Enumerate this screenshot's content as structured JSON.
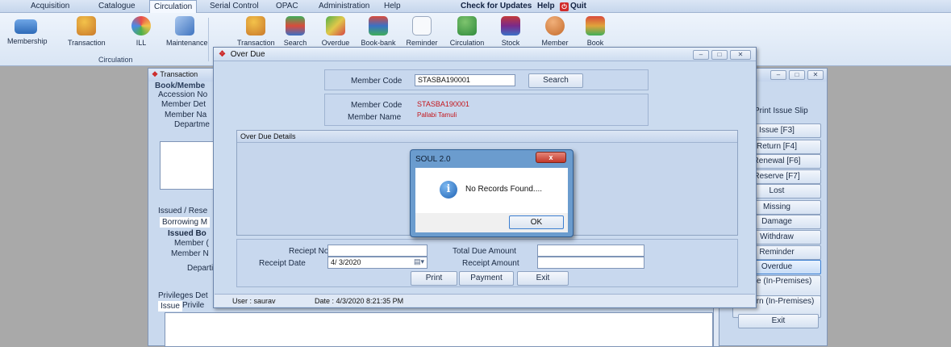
{
  "menu": {
    "items": [
      "Acquisition",
      "Catalogue",
      "Circulation",
      "Serial Control",
      "OPAC",
      "Administration",
      "Help"
    ],
    "check_updates": "Check for Updates",
    "help": "Help",
    "quit": "Quit"
  },
  "ribbon": {
    "buttons": [
      "Membership",
      "Transaction",
      "ILL",
      "Maintenance",
      "Transaction",
      "Search",
      "Overdue",
      "Book-bank",
      "Reminder",
      "Circulation",
      "Stock",
      "Member",
      "Book"
    ],
    "group_label": "Circulation"
  },
  "background_window": {
    "title": "Transaction",
    "left_labels": [
      "Book/Membe",
      "Accession No",
      "Member Det",
      "Member Na",
      "Departme",
      "Issued / Rese",
      "Borrowing M",
      "Issued Bo",
      "Member (",
      "Member N",
      "Departi",
      "Privileges Det",
      "Issue",
      "Privile"
    ],
    "print_issue_slip": "Print Issue Slip",
    "right_buttons": [
      "Issue [F3]",
      "Return [F4]",
      "Renewal [F6]",
      "Reserve [F7]",
      "Lost",
      "Missing",
      "Damage",
      "Withdraw",
      "Reminder",
      "Overdue",
      "Issue (In-Premises)",
      "Return (In-Premises)",
      "Exit"
    ]
  },
  "overdue_window": {
    "title": "Over Due",
    "member_code_label": "Member Code",
    "member_code_value": "STASBA190001",
    "search_button": "Search",
    "info_member_code_label": "Member Code",
    "info_member_code_value": "STASBA190001",
    "info_member_name_label": "Member Name",
    "info_member_name_value": "Pallabi Tamuli",
    "grid_header": "Over Due Details",
    "receipt_no_label": "Reciept No.",
    "receipt_no_value": "",
    "total_due_label": "Total Due  Amount",
    "total_due_value": "",
    "receipt_date_label": "Receipt Date",
    "receipt_date_value": "4/ 3/2020",
    "receipt_amount_label": "Receipt Amount",
    "receipt_amount_value": "",
    "print_button": "Print",
    "payment_button": "Payment",
    "exit_button": "Exit",
    "status_user": "User : saurav",
    "status_date": "Date : 4/3/2020 8:21:35 PM"
  },
  "message_box": {
    "title": "SOUL 2.0",
    "close_glyph": "x",
    "message": "No Records Found....",
    "ok_button": "OK"
  },
  "colors": {
    "accent_red": "#c4161c",
    "window_bg": "#cbdbef",
    "desktop_bg": "#a9a9a9"
  }
}
